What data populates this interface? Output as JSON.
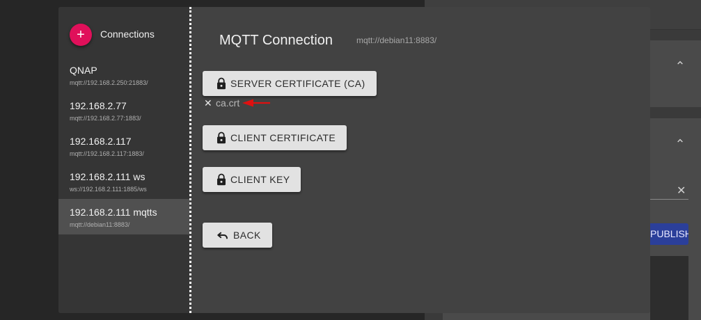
{
  "colors": {
    "accent": "#e0105a",
    "modal_bg": "#424242",
    "sidebar_bg": "#353535",
    "button_bg": "#e2e2e2",
    "publish_bg": "#2b3f9a",
    "annotation_arrow": "#e01010"
  },
  "background_app": {
    "publish_label": "PUBLISH",
    "clear_icon": "close-icon"
  },
  "sidebar": {
    "add_icon": "plus-icon",
    "title": "Connections",
    "items": [
      {
        "name": "QNAP",
        "url": "mqtt://192.168.2.250:21883/"
      },
      {
        "name": "192.168.2.77",
        "url": "mqtt://192.168.2.77:1883/"
      },
      {
        "name": "192.168.2.117",
        "url": "mqtt://192.168.2.117:1883/"
      },
      {
        "name": "192.168.2.111 ws",
        "url": "ws://192.168.2.111:1885/ws"
      },
      {
        "name": "192.168.2.111 mqtts",
        "url": "mqtt://debian11:8883/"
      }
    ],
    "active_index": 4
  },
  "main": {
    "title": "MQTT Connection",
    "url": "mqtt://debian11:8883/",
    "server_cert_label": "SERVER CERTIFICATE (CA)",
    "server_cert_file": "ca.crt",
    "client_cert_label": "CLIENT CERTIFICATE",
    "client_key_label": "CLIENT KEY",
    "back_label": "BACK",
    "lock_icon": "lock-icon",
    "back_icon": "undo-icon"
  }
}
